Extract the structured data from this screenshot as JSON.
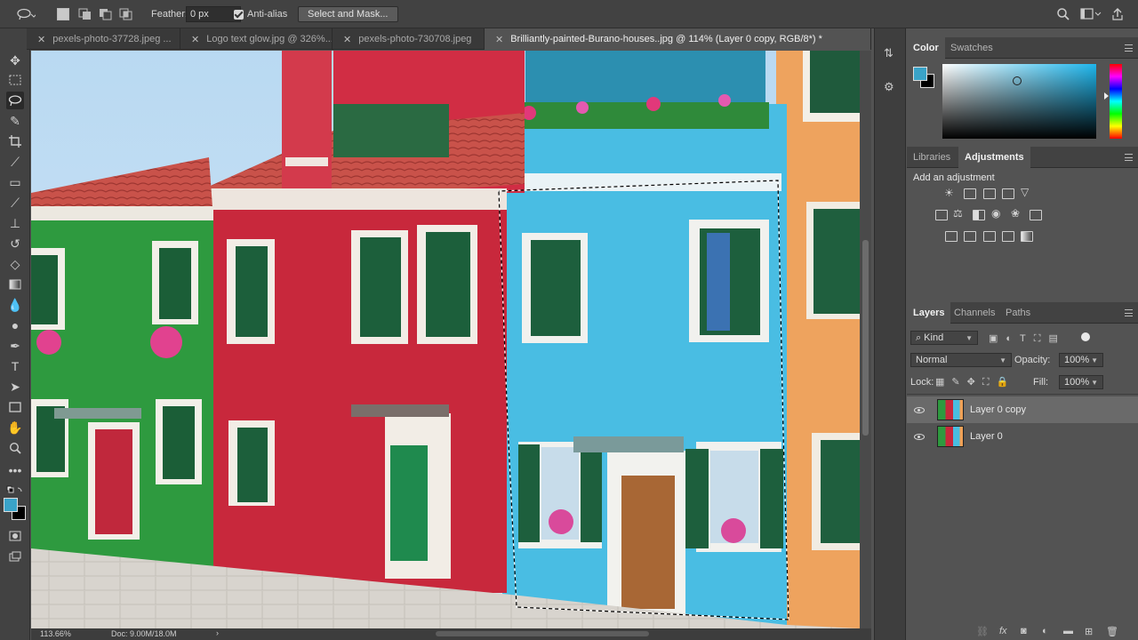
{
  "options_bar": {
    "feather_label": "Feather:",
    "feather_value": "0 px",
    "antialias_label": "Anti-alias",
    "select_mask_label": "Select and Mask..."
  },
  "tabs": [
    {
      "label": "pexels-photo-37728.jpeg ..."
    },
    {
      "label": "Logo text glow.jpg @ 326%..."
    },
    {
      "label": "pexels-photo-730708.jpeg"
    },
    {
      "label": "Brilliantly-painted-Burano-houses..jpg @ 114% (Layer 0 copy, RGB/8*) *"
    }
  ],
  "status": {
    "zoom": "113.66%",
    "doc": "Doc: 9.00M/18.0M"
  },
  "color_panel": {
    "tabs": [
      "Color",
      "Swatches"
    ],
    "foreground": "#3aa3c8",
    "background": "#000000"
  },
  "adjustments_panel": {
    "tabs": [
      "Libraries",
      "Adjustments"
    ],
    "heading": "Add an adjustment"
  },
  "layers_panel": {
    "tabs": [
      "Layers",
      "Channels",
      "Paths"
    ],
    "kind_label": "Kind",
    "blend_mode": "Normal",
    "opacity_label": "Opacity:",
    "opacity_value": "100%",
    "lock_label": "Lock:",
    "fill_label": "Fill:",
    "fill_value": "100%",
    "layers": [
      {
        "name": "Layer 0 copy"
      },
      {
        "name": "Layer 0"
      }
    ]
  }
}
